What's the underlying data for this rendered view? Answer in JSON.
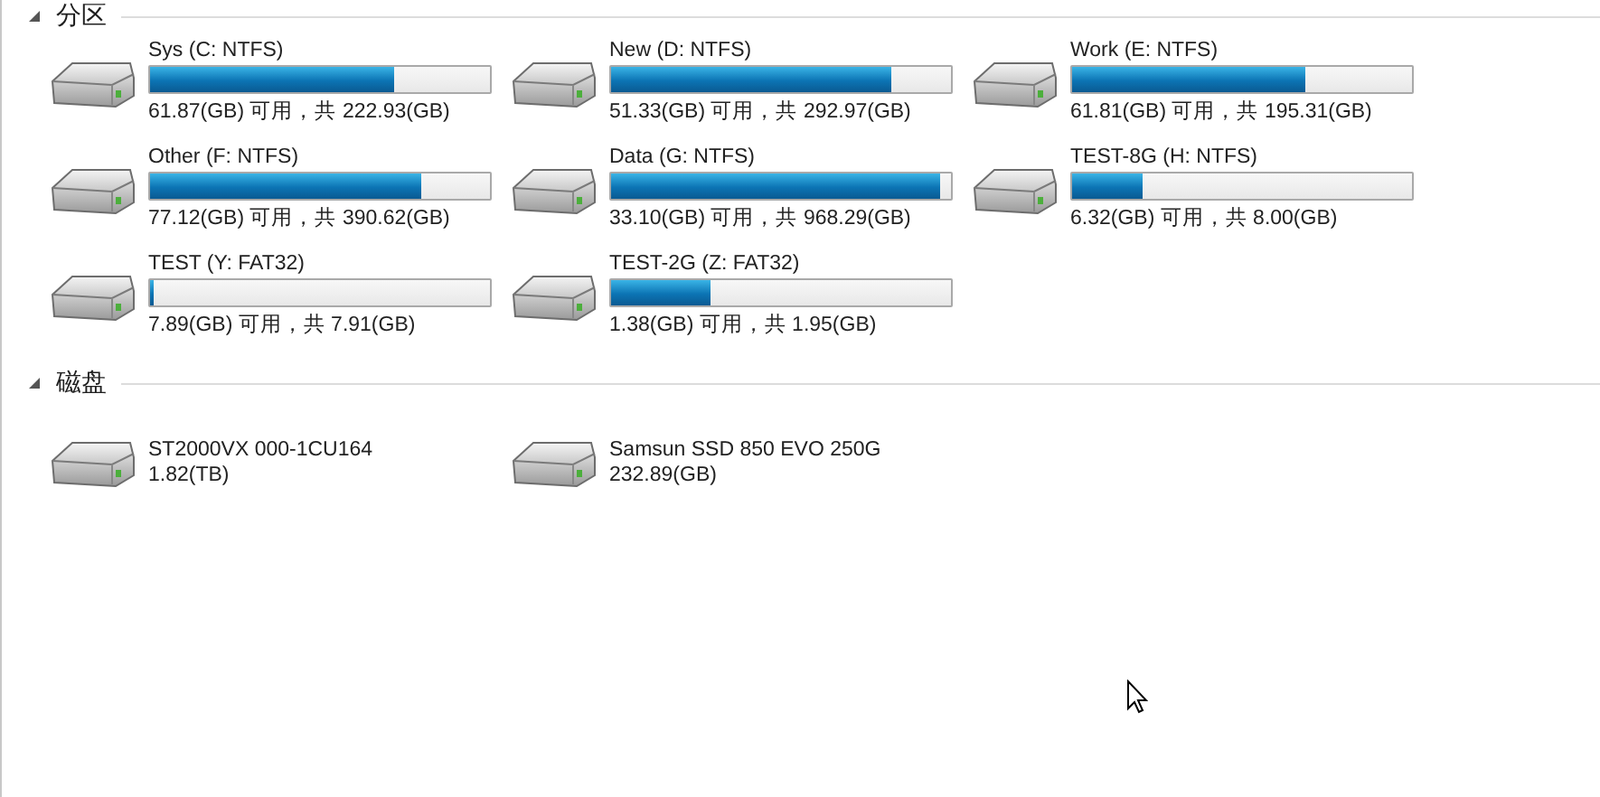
{
  "sections": [
    {
      "title": "分区",
      "expanded": true,
      "items": [
        {
          "kind": "volume",
          "name": "Sys (C: NTFS)",
          "level": 0.72,
          "detail": "61.87(GB) 可用，共 222.93(GB)"
        },
        {
          "kind": "volume",
          "name": "New (D: NTFS)",
          "level": 0.825,
          "detail": "51.33(GB) 可用，共 292.97(GB)"
        },
        {
          "kind": "volume",
          "name": "Work (E: NTFS)",
          "level": 0.684,
          "detail": "61.81(GB) 可用，共 195.31(GB)"
        },
        {
          "kind": "volume",
          "name": "Other (F: NTFS)",
          "level": 0.8,
          "detail": "77.12(GB) 可用，共 390.62(GB)"
        },
        {
          "kind": "volume",
          "name": "Data (G: NTFS)",
          "level": 0.966,
          "detail": "33.10(GB) 可用，共 968.29(GB)"
        },
        {
          "kind": "volume",
          "name": "TEST-8G (H: NTFS)",
          "level": 0.21,
          "detail": "6.32(GB) 可用，共 8.00(GB)"
        },
        {
          "kind": "volume",
          "name": "TEST (Y: FAT32)",
          "level": 0.0025,
          "detail": "7.89(GB) 可用，共 7.91(GB)"
        },
        {
          "kind": "volume",
          "name": "TEST-2G (Z: FAT32)",
          "level": 0.29,
          "detail": "1.38(GB) 可用，共 1.95(GB)"
        }
      ]
    },
    {
      "title": "磁盘",
      "expanded": true,
      "items": [
        {
          "kind": "disk",
          "name": "ST2000VX 000-1CU164",
          "detail": "1.82(TB)"
        },
        {
          "kind": "disk",
          "name": "Samsun SSD 850 EVO 250G",
          "detail": "232.89(GB)"
        }
      ]
    }
  ]
}
